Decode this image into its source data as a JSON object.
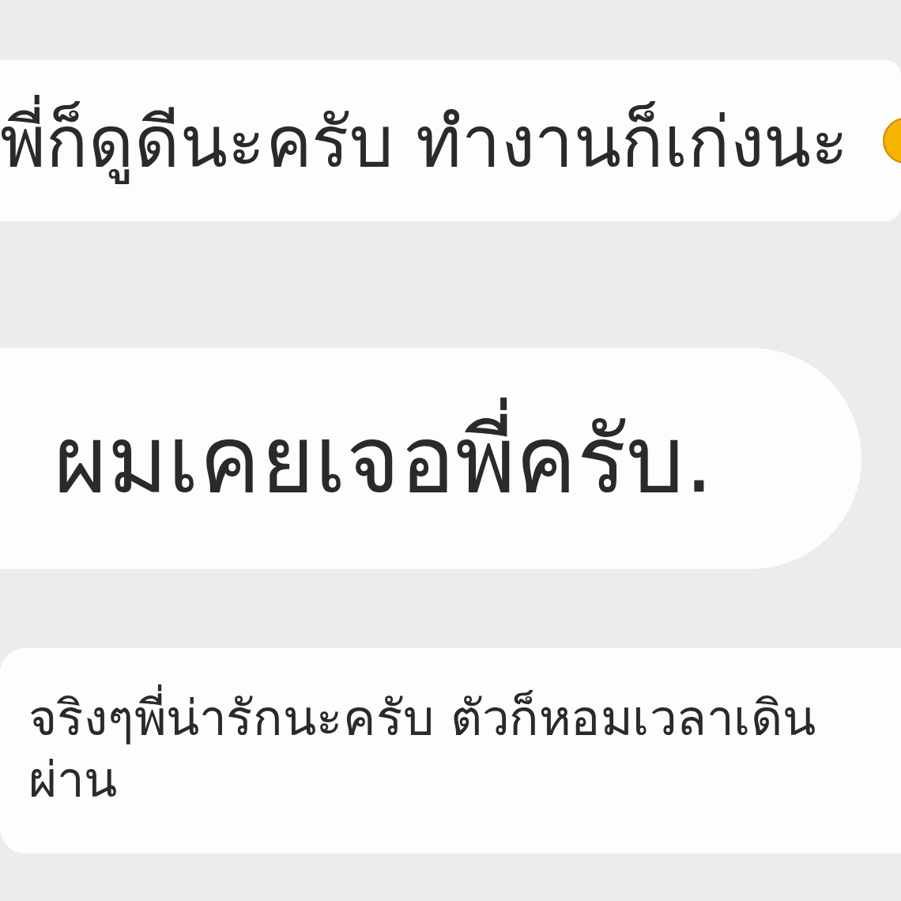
{
  "messages": [
    {
      "kind": "wide",
      "lines": [
        "พี่ก็ดูดีนะครับ ทำงานก็เก่งนะ"
      ],
      "emoji": true
    },
    {
      "kind": "large",
      "lines": [
        "ผมเคยเจอพี่ครับ."
      ],
      "emoji": false
    },
    {
      "kind": "small",
      "lines": [
        "จริงๆพี่น่ารักนะครับ ตัวก็หอมเวลาเดิน",
        "ผ่าน"
      ],
      "emoji": false
    }
  ]
}
